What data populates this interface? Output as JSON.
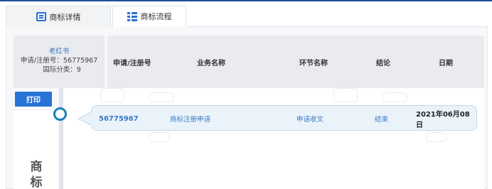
{
  "tabs": [
    {
      "label": "商标详情",
      "icon": "document-list-icon",
      "active": false
    },
    {
      "label": "商标流程",
      "icon": "list-icon",
      "active": true
    }
  ],
  "info_card": {
    "brand_name": "老红书",
    "reg_number": "申请/注册号：56775967",
    "intl_class": "国际分类：9"
  },
  "table": {
    "headers": [
      "申请/注册号",
      "业务名称",
      "环节名称",
      "结论",
      "日期"
    ],
    "rows": [
      {
        "reg_no": "56775967",
        "business": "商标注册申请",
        "stage": "申请收文",
        "result": "结束",
        "date": "2021年06月08日"
      }
    ]
  },
  "print_button": "打印",
  "side_title": [
    "商",
    "标"
  ],
  "colors": {
    "accent": "#2a73d6",
    "timeline_node": "#1a7fb8",
    "link": "#3a79c4"
  }
}
